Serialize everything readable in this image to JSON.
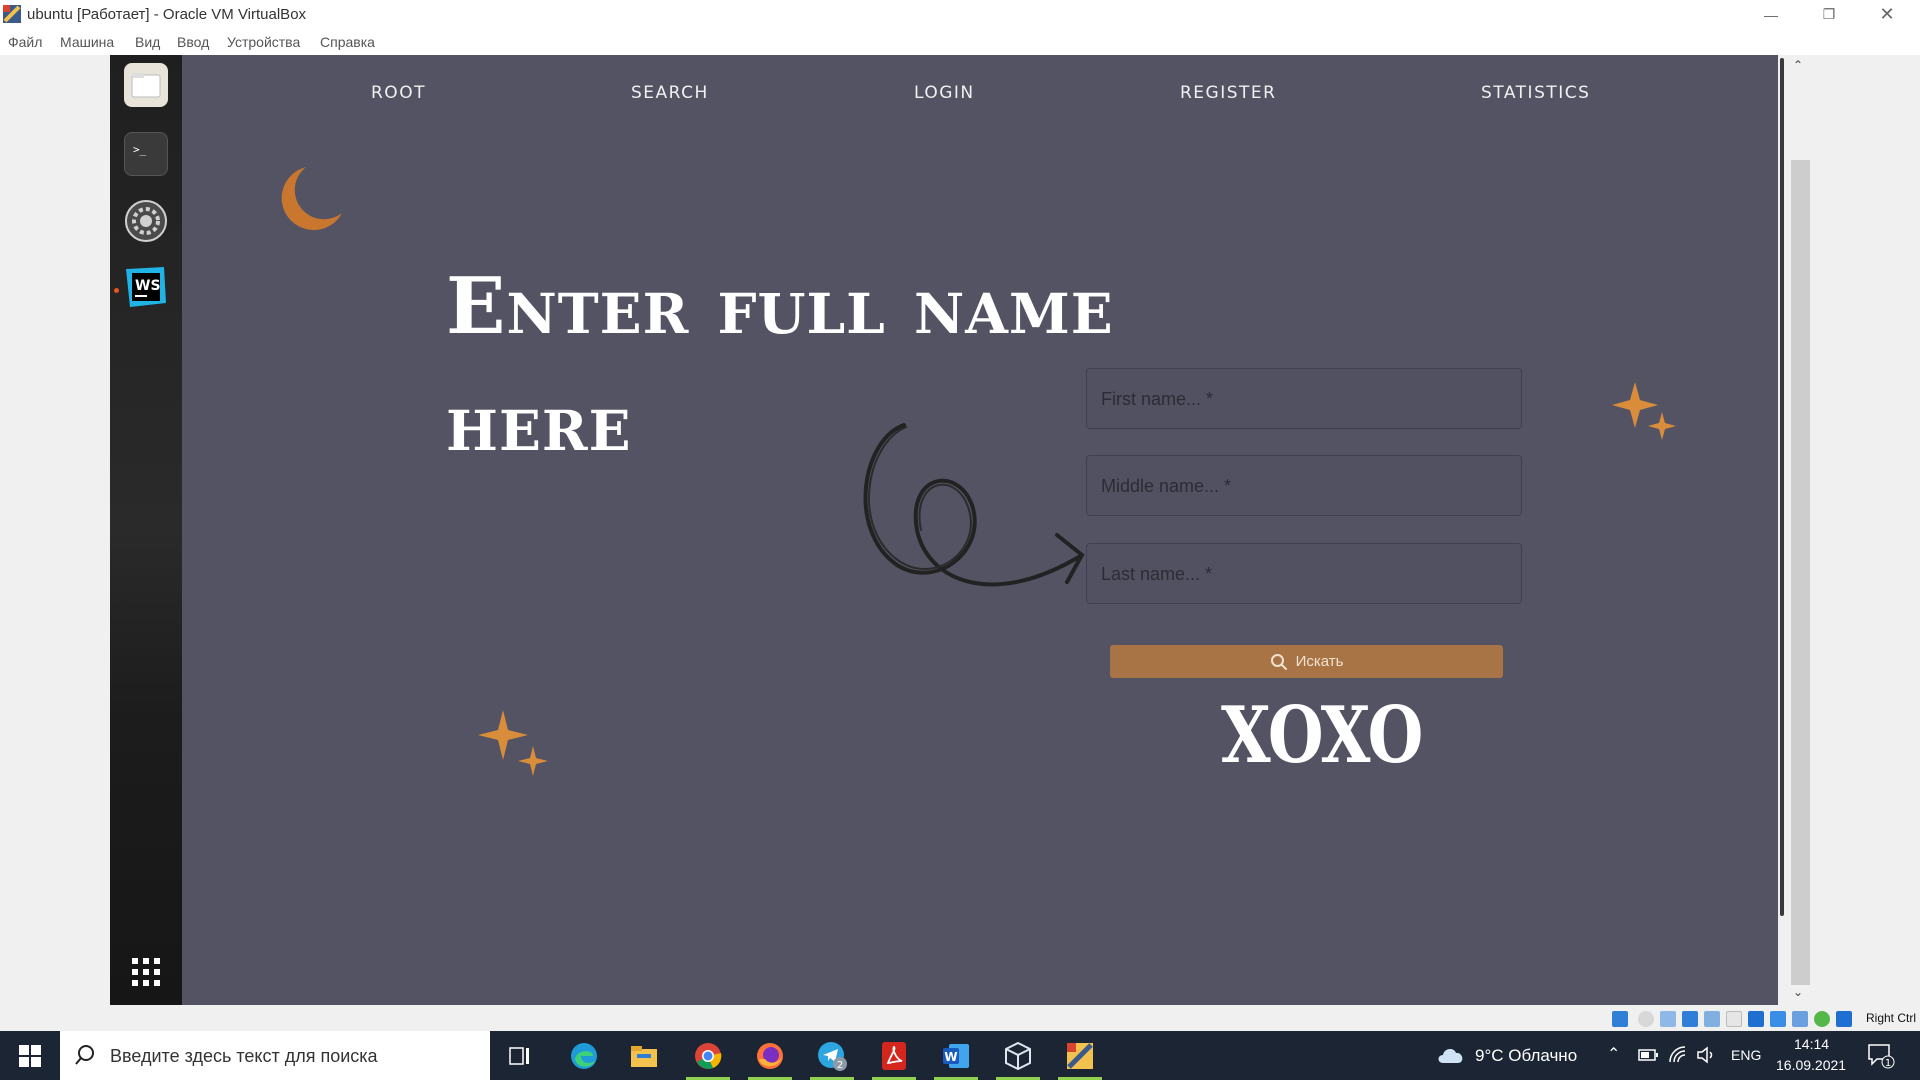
{
  "window": {
    "title": "ubuntu [Работает] - Oracle VM VirtualBox",
    "menu": [
      "Файл",
      "Машина",
      "Вид",
      "Ввод",
      "Устройства",
      "Справка"
    ]
  },
  "nav": {
    "items": [
      "ROOT",
      "SEARCH",
      "LOGIN",
      "REGISTER",
      "STATISTICS"
    ]
  },
  "hero": {
    "heading_line1": "Enter full name",
    "heading_line2": "here"
  },
  "form": {
    "first_name_placeholder": "First name... *",
    "middle_name_placeholder": "Middle name... *",
    "last_name_placeholder": "Last name... *",
    "search_label": "Искать"
  },
  "signature": "XOXO",
  "vbox_status": {
    "host_key": "Right Ctrl"
  },
  "taskbar": {
    "search_placeholder": "Введите здесь текст для поиска",
    "weather": "9°C  Облачно",
    "language": "ENG",
    "time": "14:14",
    "date": "16.09.2021",
    "telegram_badge": "2",
    "notifications_badge": "1"
  },
  "colors": {
    "page_background": "#535364",
    "accent": "#a87446",
    "star": "#d98d3a"
  }
}
